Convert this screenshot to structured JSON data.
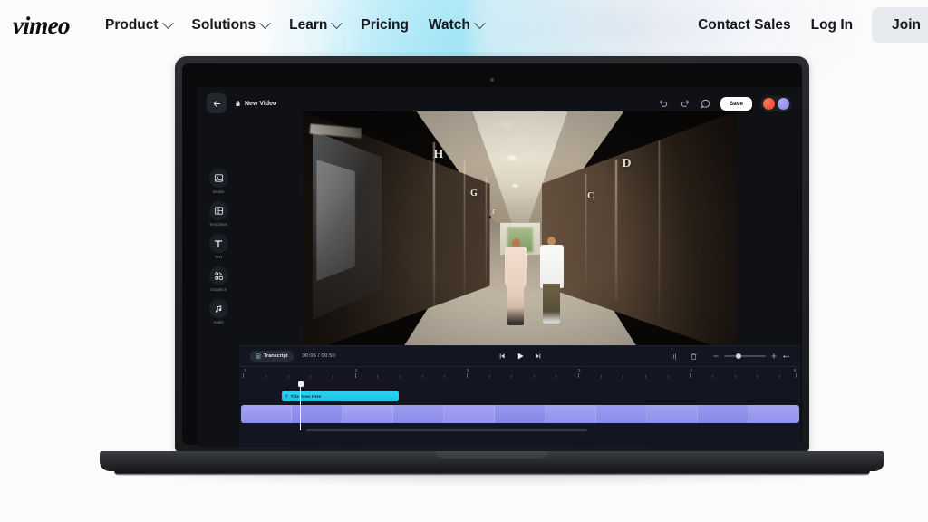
{
  "nav": {
    "logo": "vimeo",
    "items": [
      {
        "label": "Product",
        "has_caret": true
      },
      {
        "label": "Solutions",
        "has_caret": true
      },
      {
        "label": "Learn",
        "has_caret": true
      },
      {
        "label": "Pricing",
        "has_caret": false
      },
      {
        "label": "Watch",
        "has_caret": true
      }
    ],
    "contact_sales": "Contact Sales",
    "log_in": "Log In",
    "join": "Join"
  },
  "editor": {
    "back_icon": "arrow-left-icon",
    "document_title": "New Video",
    "lock_icon": "lock-icon",
    "undo_icon": "undo-icon",
    "redo_icon": "redo-icon",
    "comment_icon": "comment-icon",
    "save_label": "Save",
    "avatar_colors": [
      "#e8402b",
      "#8b8ae6"
    ],
    "tools": [
      {
        "label": "Media",
        "icon": "media-icon"
      },
      {
        "label": "Templates",
        "icon": "templates-icon"
      },
      {
        "label": "Text",
        "icon": "text-icon"
      },
      {
        "label": "Graphics",
        "icon": "graphics-icon"
      },
      {
        "label": "Audio",
        "icon": "audio-icon"
      }
    ]
  },
  "preview": {
    "elevator_letters": [
      "H",
      "G",
      "F",
      "D",
      "C"
    ],
    "scene_description": "Two people walking down a modern elevator lobby corridor"
  },
  "timeline": {
    "transcript_label": "Transcript",
    "transcript_icon": "transcript-icon",
    "current_time": "00:06",
    "total_time": "00:50",
    "time_display": "00:06 / 00:50",
    "skip_back_icon": "skip-back-icon",
    "play_icon": "play-icon",
    "skip_forward_icon": "skip-forward-icon",
    "split_icon": "split-icon",
    "delete_icon": "trash-icon",
    "zoom_out_icon": "minus-icon",
    "zoom_in_icon": "plus-icon",
    "fit_icon": "fit-width-icon",
    "zoom_value": 28,
    "ruler_labels": [
      "0",
      "1",
      "2",
      "3",
      "4",
      "5"
    ],
    "playhead_position_pct": 10.8,
    "title_clip": {
      "label": "Title Goes Here",
      "icon": "text-clip-icon",
      "start_pct": 7.6,
      "width_pct": 20.8,
      "color": "#1fc9ea"
    },
    "video_clip": {
      "start_pct": 0,
      "width_pct": 100,
      "color": "#9a9bf0",
      "segments": 11
    },
    "scrollbar": {
      "start_pct": 12,
      "width_pct": 50
    }
  }
}
